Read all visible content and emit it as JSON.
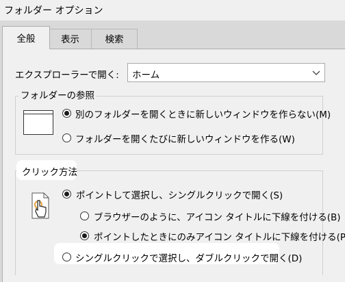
{
  "window": {
    "title": "フォルダー オプション"
  },
  "tabs": [
    {
      "label": "全般",
      "active": true
    },
    {
      "label": "表示",
      "active": false
    },
    {
      "label": "検索",
      "active": false
    }
  ],
  "explorer_open": {
    "label": "エクスプローラーで開く:",
    "value": "ホーム"
  },
  "browse_folders": {
    "title": "フォルダーの参照",
    "options": [
      {
        "label": "別のフォルダーを開くときに新しいウィンドウを作らない(M)",
        "selected": true
      },
      {
        "label": "フォルダーを開くたびに新しいウィンドウを作る(W)",
        "selected": false
      }
    ]
  },
  "click_method": {
    "title": "クリック方法",
    "options": [
      {
        "label": "ポイントして選択し、シングルクリックで開く(S)",
        "selected": true
      },
      {
        "label": "ブラウザーのように、アイコン タイトルに下線を付ける(B)",
        "selected": false
      },
      {
        "label": "ポイントしたときにのみアイコン タイトルに下線を付ける(P)",
        "selected": true
      },
      {
        "label": "シングルクリックで選択し、ダブルクリックで開く(D)",
        "selected": false
      }
    ]
  },
  "colors": {
    "highlight": "#ffffff",
    "dialog_bg": "#f0f0f0",
    "dim_bg": "#d9d9d9"
  }
}
